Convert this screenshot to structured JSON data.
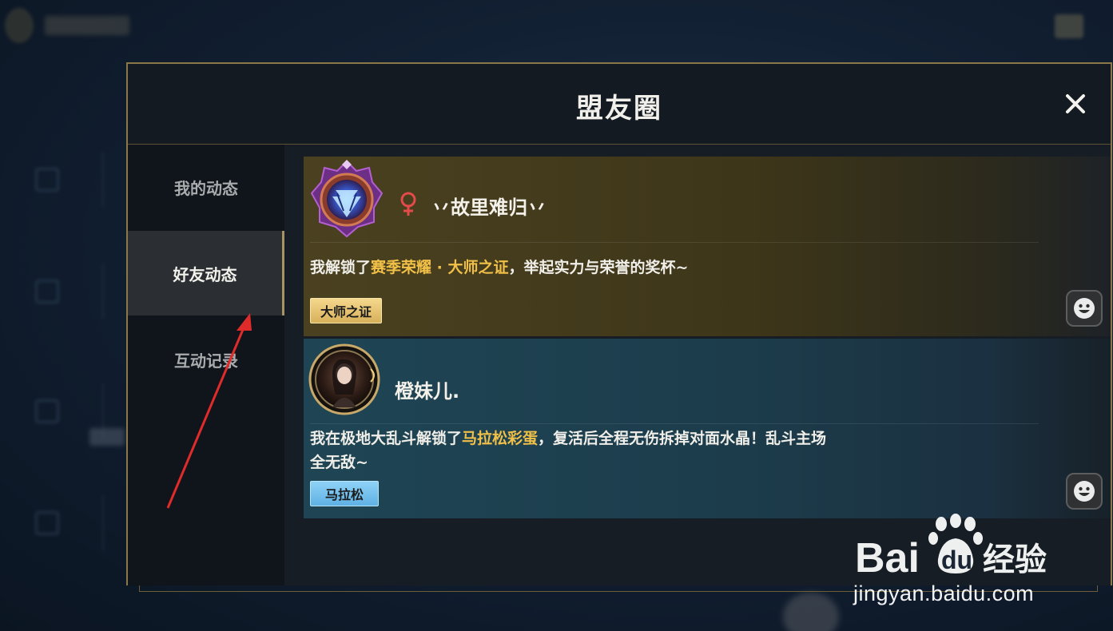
{
  "modal": {
    "title": "盟友圈",
    "close_icon": "close-icon"
  },
  "sidebar": {
    "items": [
      {
        "label": "我的动态",
        "active": false
      },
      {
        "label": "好友动态",
        "active": true
      },
      {
        "label": "互动记录",
        "active": false
      }
    ]
  },
  "feed": [
    {
      "username": "丷故里难归丷",
      "gender_icon": "female-icon",
      "avatar_icon": "diamond-rank-emblem-icon",
      "text_parts": [
        "我解锁了",
        "赛季荣耀 · 大师之证",
        "，举起实力与荣誉的奖杯~"
      ],
      "tag": "大师之证",
      "react_icon": "smiley-face-icon"
    },
    {
      "username": "橙妹儿.",
      "avatar_icon": "user-portrait-avatar",
      "text_line1_parts": [
        "我在极地大乱斗解锁了",
        "马拉松彩蛋",
        "，复活后全程无伤拆掉对面水晶！乱斗主场"
      ],
      "text_line2": "全无敌~",
      "tag": "马拉松",
      "react_icon": "smiley-face-icon"
    }
  ],
  "watermark": {
    "brand": "Bai du 经验",
    "url": "jingyan.baidu.com"
  },
  "colors": {
    "frame_gold": "#8b7848",
    "highlight": "#f1c048",
    "gold_card": "#4a4120",
    "teal_card": "#1f4555",
    "annotation_arrow": "#e02b2b"
  }
}
